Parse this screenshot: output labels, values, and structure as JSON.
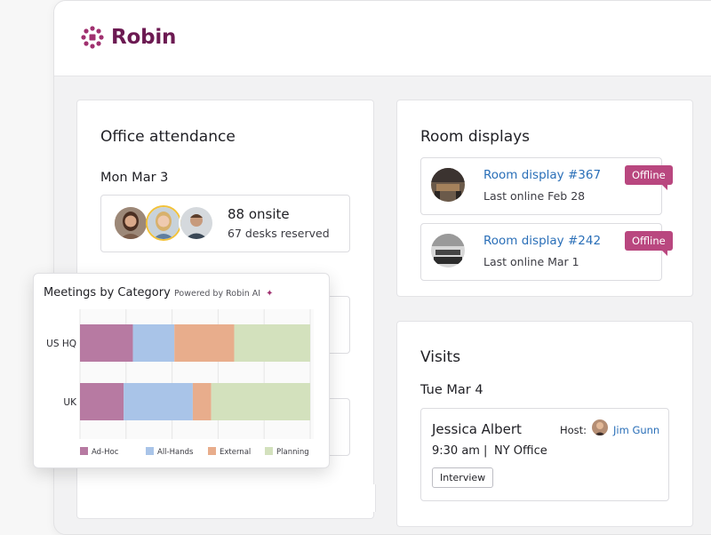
{
  "brand": {
    "name": "Robin",
    "color": "#6c1a52"
  },
  "attendance": {
    "title": "Office attendance",
    "date": "Mon Mar 3",
    "onsite": "88 onsite",
    "desks": "67 desks reserved"
  },
  "room_displays": {
    "title": "Room displays",
    "items": [
      {
        "name": "Room display #367",
        "last_online": "Last online Feb 28",
        "status": "Offline"
      },
      {
        "name": "Room display #242",
        "last_online": "Last online Mar 1",
        "status": "Offline"
      }
    ]
  },
  "visits": {
    "title": "Visits",
    "date": "Tue Mar 4",
    "visitor": "Jessica Albert",
    "host_label": "Host:",
    "host_name": "Jim Gunn",
    "time": "9:30 am",
    "separator": "|",
    "location": "NY Office",
    "tag": "Interview"
  },
  "chart_widget": {
    "title": "Meetings by Category",
    "subtitle": "Powered by Robin AI",
    "sparkle_icon": "sparkle-icon"
  },
  "chart_data": {
    "type": "bar",
    "orientation": "horizontal",
    "stacked": true,
    "categories": [
      "US HQ",
      "UK"
    ],
    "series": [
      {
        "name": "Ad-Hoc",
        "color": "#b77aa2",
        "values": [
          23,
          19
        ]
      },
      {
        "name": "All-Hands",
        "color": "#a9c4e8",
        "values": [
          18,
          30
        ]
      },
      {
        "name": "External",
        "color": "#e8ad8c",
        "values": [
          26,
          8
        ]
      },
      {
        "name": "Planning",
        "color": "#d3e1bd",
        "values": [
          33,
          43
        ]
      }
    ],
    "xlim": [
      0,
      100
    ],
    "grid": true,
    "legend": "bottom"
  }
}
